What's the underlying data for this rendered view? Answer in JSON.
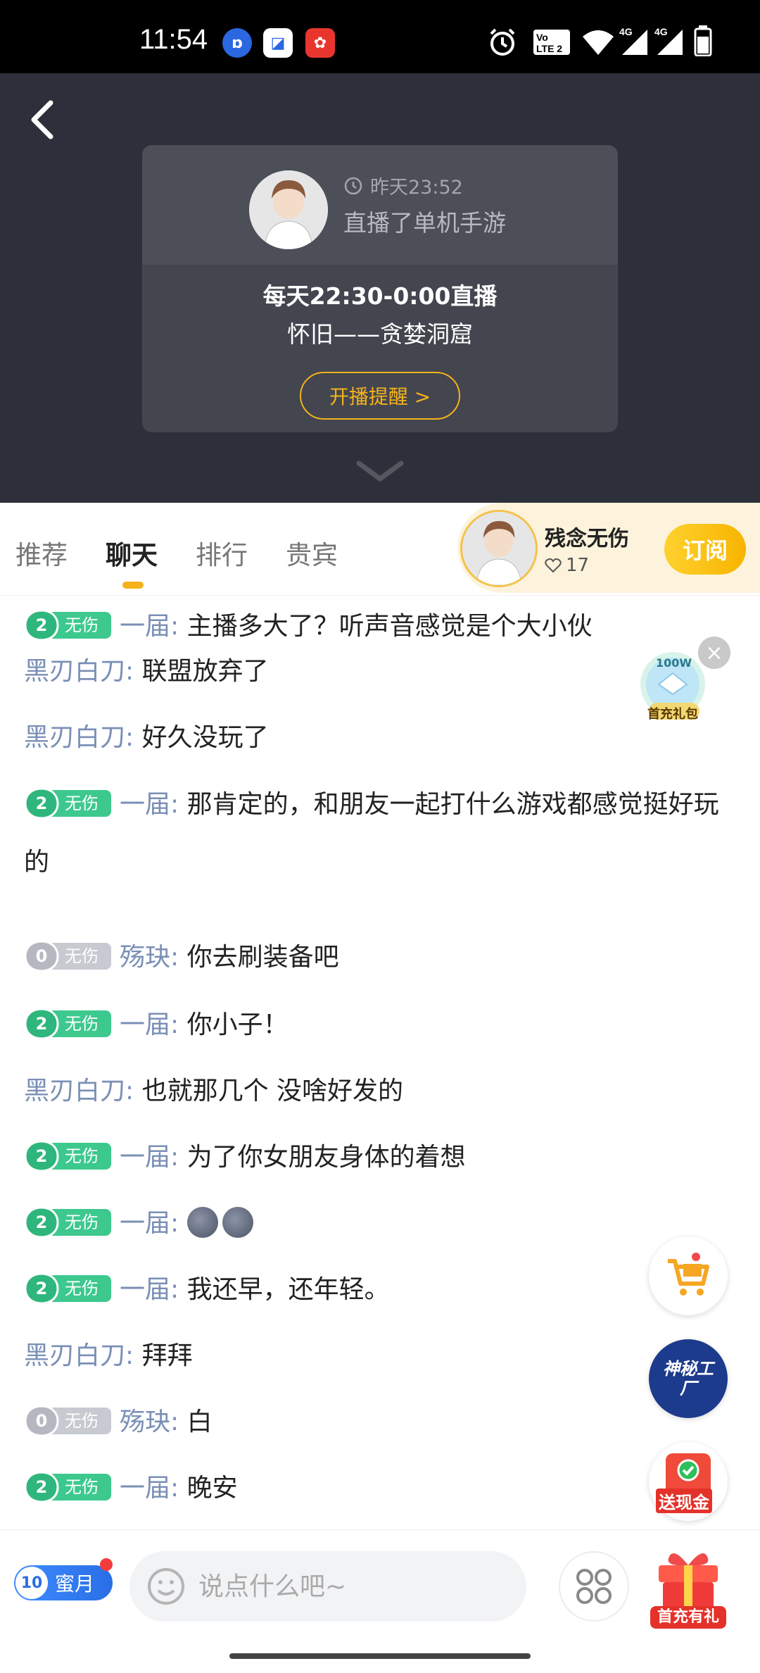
{
  "status_bar": {
    "time": "11:54",
    "icons": [
      "alarm-icon",
      "volte-icon",
      "wifi-icon",
      "signal-4g-icon",
      "signal-4g-icon",
      "battery-icon"
    ],
    "apps": [
      "baidu-app-icon",
      "box-app-icon",
      "red-app-icon"
    ]
  },
  "header": {
    "back_icon": "chevron-left-icon",
    "card": {
      "time": "昨天23:52",
      "desc": "直播了单机手游",
      "schedule": "每天22:30-0:00直播",
      "subtitle": "怀旧——贪婪洞窟",
      "remind_label": "开播提醒 >"
    }
  },
  "tabs": [
    "推荐",
    "聊天",
    "排行",
    "贵宾"
  ],
  "active_tab": 1,
  "anchor": {
    "name": "残念无伤",
    "likes": "17",
    "subscribe_label": "订阅"
  },
  "chat": [
    {
      "badge": {
        "level": "2",
        "label": "无伤",
        "style": "green"
      },
      "nick": "一届",
      "sep": ":",
      "text": "主播多大了？听声音感觉是个大小伙"
    },
    {
      "badge": null,
      "nick": "黑刃白刀",
      "sep": ":",
      "text": "联盟放弃了"
    },
    {
      "badge": null,
      "nick": "黑刃白刀",
      "sep": ":",
      "text": "好久没玩了"
    },
    {
      "badge": {
        "level": "2",
        "label": "无伤",
        "style": "green"
      },
      "nick": "一届",
      "sep": ":",
      "text": "那肯定的，和朋友一起打什么游戏都感觉挺好玩的"
    },
    {
      "badge": {
        "level": "0",
        "label": "无伤",
        "style": "gray"
      },
      "nick": "殇玦",
      "sep": ":",
      "text": "你去刷装备吧"
    },
    {
      "badge": {
        "level": "2",
        "label": "无伤",
        "style": "green"
      },
      "nick": "一届",
      "sep": ":",
      "text": "你小子！"
    },
    {
      "badge": null,
      "nick": "黑刃白刀",
      "sep": ":",
      "text": "也就那几个  没啥好发的"
    },
    {
      "badge": {
        "level": "2",
        "label": "无伤",
        "style": "green"
      },
      "nick": "一届",
      "sep": ":",
      "text": "为了你女朋友身体的着想"
    },
    {
      "badge": {
        "level": "2",
        "label": "无伤",
        "style": "green"
      },
      "nick": "一届",
      "sep": ":",
      "text": "",
      "emoji": [
        "moon-face-icon",
        "moon-face-icon"
      ]
    },
    {
      "badge": {
        "level": "2",
        "label": "无伤",
        "style": "green"
      },
      "nick": "一届",
      "sep": ":",
      "text": "我还早，还年轻。"
    },
    {
      "badge": null,
      "nick": "黑刃白刀",
      "sep": ":",
      "text": "拜拜"
    },
    {
      "badge": {
        "level": "0",
        "label": "无伤",
        "style": "gray"
      },
      "nick": "殇玦",
      "sep": ":",
      "text": "白"
    },
    {
      "badge": {
        "level": "2",
        "label": "无伤",
        "style": "green"
      },
      "nick": "一届",
      "sep": ":",
      "text": "晚安"
    }
  ],
  "floating": {
    "gift_pack_top": "100W",
    "gift_pack_label": "首充礼包",
    "cart_icon": "shopping-cart-icon",
    "mystery_label": "神秘工厂",
    "cash_label": "送现金"
  },
  "bottom": {
    "honey_level": "10",
    "honey_label": "蜜月",
    "input_placeholder": "说点什么吧~",
    "more_icon": "grid-icon",
    "gift_label": "首充有礼"
  },
  "colors": {
    "accent": "#f5b21b",
    "nick": "#7a8fb6",
    "badge_green": "#3dc88e",
    "badge_gray": "#c7cad1",
    "hero_bg": "#2d2f3a"
  }
}
